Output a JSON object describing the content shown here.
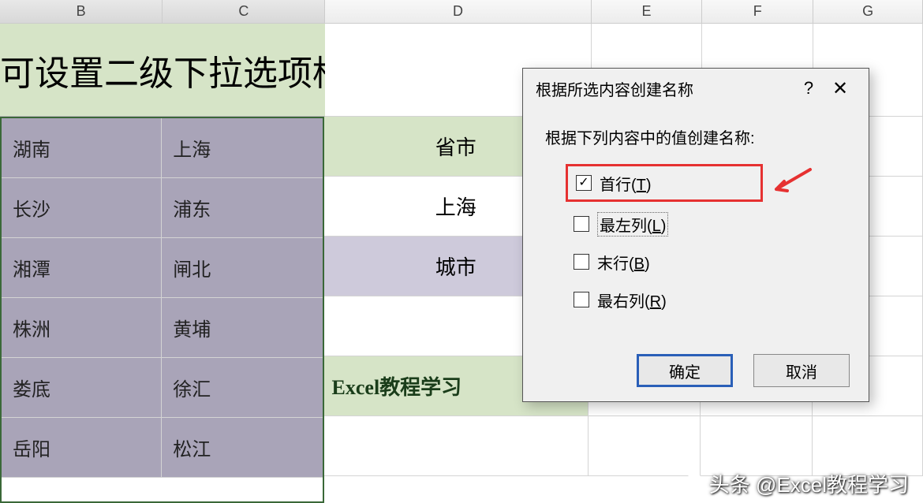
{
  "columns": [
    "B",
    "C",
    "D",
    "E",
    "F",
    "G"
  ],
  "title": "可设置二级下拉选项框",
  "selected_table": {
    "rows": [
      [
        "湖南",
        "上海"
      ],
      [
        "长沙",
        "浦东"
      ],
      [
        "湘潭",
        "闸北"
      ],
      [
        "株洲",
        "黄埔"
      ],
      [
        "娄底",
        "徐汇"
      ],
      [
        "岳阳",
        "松江"
      ]
    ]
  },
  "d_column": {
    "cells": [
      {
        "text": "省市",
        "style": "header"
      },
      {
        "text": "上海",
        "style": "norm"
      },
      {
        "text": "城市",
        "style": "alt"
      },
      {
        "text": "",
        "style": "norm"
      },
      {
        "text": "Excel教程学习",
        "style": "label"
      },
      {
        "text": "",
        "style": "norm"
      }
    ]
  },
  "dialog": {
    "title": "根据所选内容创建名称",
    "help": "?",
    "label": "根据下列内容中的值创建名称:",
    "options": [
      {
        "label": "首行",
        "mnemonic": "T",
        "checked": true,
        "highlighted": true
      },
      {
        "label": "最左列",
        "mnemonic": "L",
        "checked": false,
        "dotted": true
      },
      {
        "label": "末行",
        "mnemonic": "B",
        "checked": false
      },
      {
        "label": "最右列",
        "mnemonic": "R",
        "checked": false
      }
    ],
    "ok": "确定",
    "cancel": "取消"
  },
  "watermark": "头条 @Excel教程学习"
}
